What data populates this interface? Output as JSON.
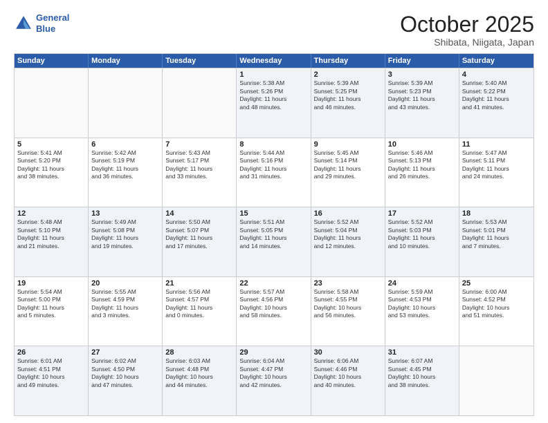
{
  "logo": {
    "line1": "General",
    "line2": "Blue"
  },
  "title": "October 2025",
  "subtitle": "Shibata, Niigata, Japan",
  "weekdays": [
    "Sunday",
    "Monday",
    "Tuesday",
    "Wednesday",
    "Thursday",
    "Friday",
    "Saturday"
  ],
  "weeks": [
    [
      {
        "day": "",
        "info": ""
      },
      {
        "day": "",
        "info": ""
      },
      {
        "day": "",
        "info": ""
      },
      {
        "day": "1",
        "info": "Sunrise: 5:38 AM\nSunset: 5:26 PM\nDaylight: 11 hours\nand 48 minutes."
      },
      {
        "day": "2",
        "info": "Sunrise: 5:39 AM\nSunset: 5:25 PM\nDaylight: 11 hours\nand 46 minutes."
      },
      {
        "day": "3",
        "info": "Sunrise: 5:39 AM\nSunset: 5:23 PM\nDaylight: 11 hours\nand 43 minutes."
      },
      {
        "day": "4",
        "info": "Sunrise: 5:40 AM\nSunset: 5:22 PM\nDaylight: 11 hours\nand 41 minutes."
      }
    ],
    [
      {
        "day": "5",
        "info": "Sunrise: 5:41 AM\nSunset: 5:20 PM\nDaylight: 11 hours\nand 38 minutes."
      },
      {
        "day": "6",
        "info": "Sunrise: 5:42 AM\nSunset: 5:19 PM\nDaylight: 11 hours\nand 36 minutes."
      },
      {
        "day": "7",
        "info": "Sunrise: 5:43 AM\nSunset: 5:17 PM\nDaylight: 11 hours\nand 33 minutes."
      },
      {
        "day": "8",
        "info": "Sunrise: 5:44 AM\nSunset: 5:16 PM\nDaylight: 11 hours\nand 31 minutes."
      },
      {
        "day": "9",
        "info": "Sunrise: 5:45 AM\nSunset: 5:14 PM\nDaylight: 11 hours\nand 29 minutes."
      },
      {
        "day": "10",
        "info": "Sunrise: 5:46 AM\nSunset: 5:13 PM\nDaylight: 11 hours\nand 26 minutes."
      },
      {
        "day": "11",
        "info": "Sunrise: 5:47 AM\nSunset: 5:11 PM\nDaylight: 11 hours\nand 24 minutes."
      }
    ],
    [
      {
        "day": "12",
        "info": "Sunrise: 5:48 AM\nSunset: 5:10 PM\nDaylight: 11 hours\nand 21 minutes."
      },
      {
        "day": "13",
        "info": "Sunrise: 5:49 AM\nSunset: 5:08 PM\nDaylight: 11 hours\nand 19 minutes."
      },
      {
        "day": "14",
        "info": "Sunrise: 5:50 AM\nSunset: 5:07 PM\nDaylight: 11 hours\nand 17 minutes."
      },
      {
        "day": "15",
        "info": "Sunrise: 5:51 AM\nSunset: 5:05 PM\nDaylight: 11 hours\nand 14 minutes."
      },
      {
        "day": "16",
        "info": "Sunrise: 5:52 AM\nSunset: 5:04 PM\nDaylight: 11 hours\nand 12 minutes."
      },
      {
        "day": "17",
        "info": "Sunrise: 5:52 AM\nSunset: 5:03 PM\nDaylight: 11 hours\nand 10 minutes."
      },
      {
        "day": "18",
        "info": "Sunrise: 5:53 AM\nSunset: 5:01 PM\nDaylight: 11 hours\nand 7 minutes."
      }
    ],
    [
      {
        "day": "19",
        "info": "Sunrise: 5:54 AM\nSunset: 5:00 PM\nDaylight: 11 hours\nand 5 minutes."
      },
      {
        "day": "20",
        "info": "Sunrise: 5:55 AM\nSunset: 4:59 PM\nDaylight: 11 hours\nand 3 minutes."
      },
      {
        "day": "21",
        "info": "Sunrise: 5:56 AM\nSunset: 4:57 PM\nDaylight: 11 hours\nand 0 minutes."
      },
      {
        "day": "22",
        "info": "Sunrise: 5:57 AM\nSunset: 4:56 PM\nDaylight: 10 hours\nand 58 minutes."
      },
      {
        "day": "23",
        "info": "Sunrise: 5:58 AM\nSunset: 4:55 PM\nDaylight: 10 hours\nand 56 minutes."
      },
      {
        "day": "24",
        "info": "Sunrise: 5:59 AM\nSunset: 4:53 PM\nDaylight: 10 hours\nand 53 minutes."
      },
      {
        "day": "25",
        "info": "Sunrise: 6:00 AM\nSunset: 4:52 PM\nDaylight: 10 hours\nand 51 minutes."
      }
    ],
    [
      {
        "day": "26",
        "info": "Sunrise: 6:01 AM\nSunset: 4:51 PM\nDaylight: 10 hours\nand 49 minutes."
      },
      {
        "day": "27",
        "info": "Sunrise: 6:02 AM\nSunset: 4:50 PM\nDaylight: 10 hours\nand 47 minutes."
      },
      {
        "day": "28",
        "info": "Sunrise: 6:03 AM\nSunset: 4:48 PM\nDaylight: 10 hours\nand 44 minutes."
      },
      {
        "day": "29",
        "info": "Sunrise: 6:04 AM\nSunset: 4:47 PM\nDaylight: 10 hours\nand 42 minutes."
      },
      {
        "day": "30",
        "info": "Sunrise: 6:06 AM\nSunset: 4:46 PM\nDaylight: 10 hours\nand 40 minutes."
      },
      {
        "day": "31",
        "info": "Sunrise: 6:07 AM\nSunset: 4:45 PM\nDaylight: 10 hours\nand 38 minutes."
      },
      {
        "day": "",
        "info": ""
      }
    ]
  ],
  "alt_rows": [
    0,
    2,
    4
  ]
}
